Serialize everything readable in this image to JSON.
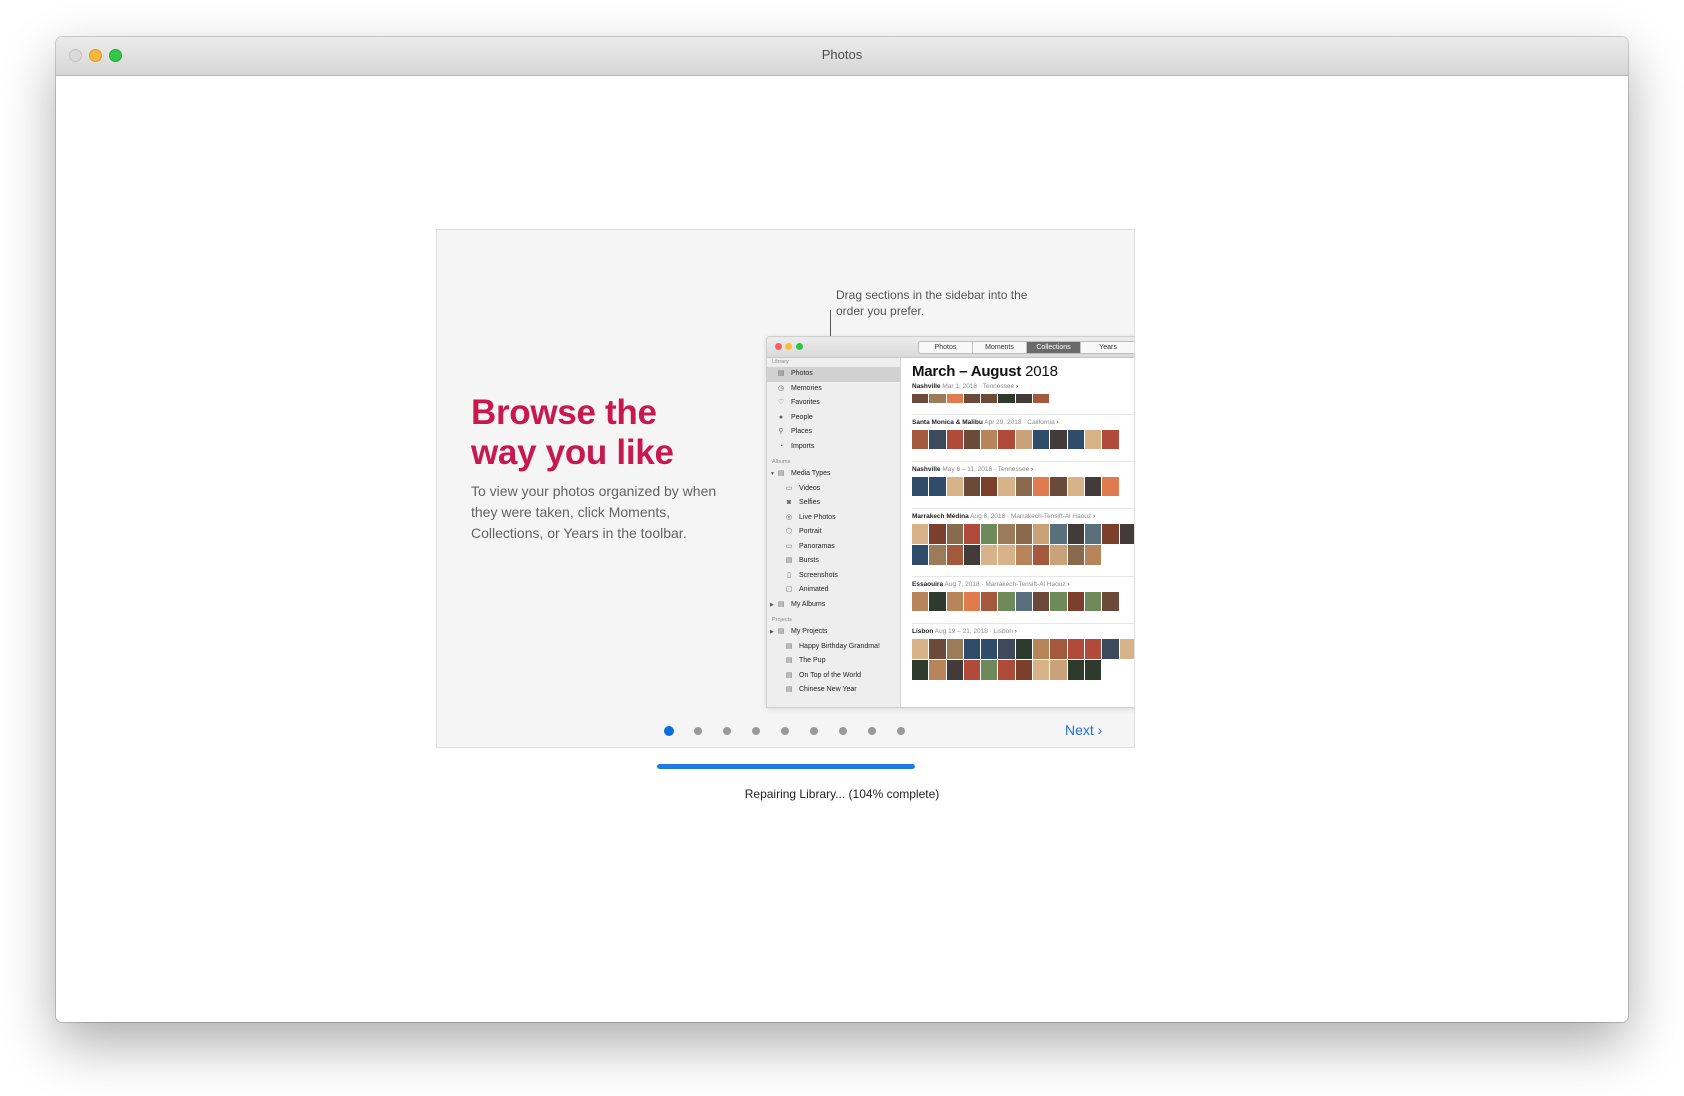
{
  "window": {
    "title": "Photos"
  },
  "onboarding": {
    "headline": "Browse the way you like",
    "description": "To view your photos organized by when they were taken, click Moments, Collections, or Years in the toolbar.",
    "callout": "Drag sections in the sidebar into the order you prefer.",
    "next_label": "Next ›",
    "page_count": 9,
    "current_page": 1
  },
  "illustration": {
    "tabs": [
      {
        "label": "Photos",
        "active": false
      },
      {
        "label": "Moments",
        "active": false
      },
      {
        "label": "Collections",
        "active": true
      },
      {
        "label": "Years",
        "active": false
      }
    ],
    "sidebar": {
      "library_heading": "Library",
      "library_items": [
        {
          "label": "Photos",
          "icon": "photos-icon",
          "selected": true
        },
        {
          "label": "Memories",
          "icon": "memories-icon"
        },
        {
          "label": "Favorites",
          "icon": "heart-icon"
        },
        {
          "label": "People",
          "icon": "person-icon"
        },
        {
          "label": "Places",
          "icon": "pin-icon"
        },
        {
          "label": "Imports",
          "icon": "clock-icon"
        }
      ],
      "albums_heading": "Albums",
      "media_types_label": "Media Types",
      "media_types": [
        {
          "label": "Videos",
          "icon": "video-icon"
        },
        {
          "label": "Selfies",
          "icon": "camera-icon"
        },
        {
          "label": "Live Photos",
          "icon": "live-photo-icon"
        },
        {
          "label": "Portrait",
          "icon": "cube-icon"
        },
        {
          "label": "Panoramas",
          "icon": "panorama-icon"
        },
        {
          "label": "Bursts",
          "icon": "bursts-icon"
        },
        {
          "label": "Screenshots",
          "icon": "screenshot-icon"
        },
        {
          "label": "Animated",
          "icon": "animated-icon"
        }
      ],
      "my_albums_label": "My Albums",
      "projects_heading": "Projects",
      "my_projects_label": "My Projects",
      "projects": [
        "Happy Birthday Grandma!",
        "The Pup",
        "On Top of the World",
        "Chinese New Year"
      ]
    },
    "main_title_bold": "March – August",
    "main_title_year": "2018",
    "moments": [
      {
        "name": "Nashville",
        "date": "Mar 1, 2018",
        "place": "Tennessee",
        "chevron": "›"
      },
      {
        "name": "Santa Monica & Malibu",
        "date": "Apr 29, 2018",
        "place": "California",
        "chevron": "›"
      },
      {
        "name": "Nashville",
        "date": "May 6 – 11, 2018",
        "place": "Tennessee",
        "chevron": "›"
      },
      {
        "name": "Marrakech Médina",
        "date": "Aug 6, 2018",
        "place": "Marrakech-Tensift-Al Haouz",
        "chevron": "›"
      },
      {
        "name": "Essaouira",
        "date": "Aug 7, 2018",
        "place": "Marrakech-Tensift-Al Haouz",
        "chevron": "›"
      },
      {
        "name": "Lisbon",
        "date": "Aug 19 – 21, 2018",
        "place": "Lisbon",
        "chevron": "›"
      }
    ]
  },
  "progress": {
    "percent": 100,
    "text": "Repairing Library... (104% complete)"
  }
}
